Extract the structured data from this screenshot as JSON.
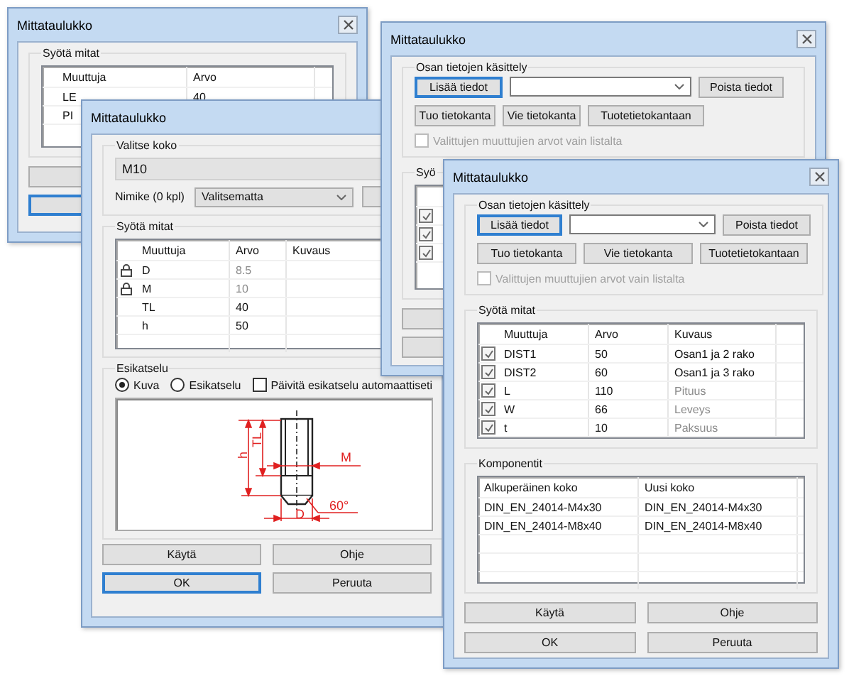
{
  "back_window": {
    "title": "Mittataulukko",
    "group_label": "Syötä mitat",
    "columns": [
      "Muuttuja",
      "Arvo"
    ],
    "rows": [
      {
        "name": "LE",
        "value": "40"
      },
      {
        "name": "PI"
      }
    ],
    "buttons": [
      {
        "default": false
      },
      {
        "default": true
      }
    ]
  },
  "size_window": {
    "title": "Mittataulukko",
    "size_group": "Valitse koko",
    "size_value": "M10",
    "item_label": "Nimike (0 kpl)",
    "item_select": "Valitsematta",
    "dims_group": "Syötä mitat",
    "columns": [
      "Muuttuja",
      "Arvo",
      "Kuvaus"
    ],
    "rows": [
      {
        "name": "D",
        "value": "8.5",
        "locked": true
      },
      {
        "name": "M",
        "value": "10",
        "locked": true
      },
      {
        "name": "TL",
        "value": "40",
        "locked": false
      },
      {
        "name": "h",
        "value": "50",
        "locked": false
      }
    ],
    "preview_group": "Esikatselu",
    "preview_modes": [
      {
        "label": "Kuva",
        "selected": true
      },
      {
        "label": "Esikatselu",
        "selected": false
      }
    ],
    "auto_update": {
      "label": "Päivitä esikatselu automaattiseti",
      "checked": false
    },
    "drawing_labels": [
      "h",
      "TL",
      "M",
      "D",
      "60°"
    ],
    "buttons": [
      {
        "label": "Käytä",
        "default": false
      },
      {
        "label": "Ohje",
        "default": false
      },
      {
        "label": "OK",
        "default": true
      },
      {
        "label": "Peruuta",
        "default": false
      }
    ]
  },
  "database_window": {
    "title": "Mittataulukko",
    "data_group": "Osan tietojen käsittely",
    "data_rows": [
      [
        {
          "kind": "button",
          "label": "Lisää tiedot",
          "focused": true
        },
        {
          "kind": "combo"
        },
        {
          "kind": "button",
          "label": "Poista tiedot",
          "focused": false
        }
      ],
      [
        {
          "kind": "button",
          "label": "Tuo tietokanta",
          "focused": false
        },
        {
          "kind": "button",
          "label": "Vie tietokanta",
          "focused": false
        },
        {
          "kind": "button",
          "label": "Tuotetietokantaan",
          "focused": false
        }
      ]
    ],
    "list_only": {
      "label": "Valittujen muuttujien arvot vain listalta",
      "checked": false,
      "disabled": true
    },
    "dims_group": "Syö",
    "rows": [
      {
        "checked": true
      },
      {
        "checked": true
      },
      {
        "checked": true
      }
    ],
    "lower_buttons": [
      {
        "default": false
      },
      {
        "default": false
      }
    ]
  },
  "front_window": {
    "title": "Mittataulukko",
    "data_group": "Osan tietojen käsittely",
    "data_rows": [
      [
        {
          "kind": "button",
          "label": "Lisää tiedot",
          "focused": true
        },
        {
          "kind": "combo"
        },
        {
          "kind": "button",
          "label": "Poista tiedot",
          "focused": false
        }
      ],
      [
        {
          "kind": "button",
          "label": "Tuo tietokanta",
          "focused": false
        },
        {
          "kind": "button",
          "label": "Vie tietokanta",
          "focused": false
        },
        {
          "kind": "button",
          "label": "Tuotetietokantaan",
          "focused": false
        }
      ]
    ],
    "list_only": {
      "label": "Valittujen muuttujien arvot vain listalta",
      "checked": false,
      "disabled": true
    },
    "dims_group": "Syötä mitat",
    "columns": [
      "Muuttuja",
      "Arvo",
      "Kuvaus"
    ],
    "rows": [
      {
        "checked": true,
        "name": "DIST1",
        "value": "50",
        "description": "Osan1 ja 2 rako",
        "greyed": false
      },
      {
        "checked": true,
        "name": "DIST2",
        "value": "60",
        "description": "Osan1 ja 3 rako",
        "greyed": false
      },
      {
        "checked": true,
        "name": "L",
        "value": "110",
        "description": "Pituus",
        "greyed": true
      },
      {
        "checked": true,
        "name": "W",
        "value": "66",
        "description": "Leveys",
        "greyed": true
      },
      {
        "checked": true,
        "name": "t",
        "value": "10",
        "description": "Paksuus",
        "greyed": true
      }
    ],
    "components_group": "Komponentit",
    "component_columns": [
      "Alkuperäinen koko",
      "Uusi koko"
    ],
    "components": [
      {
        "original": "DIN_EN_24014-M4x30",
        "new": "DIN_EN_24014-M4x30"
      },
      {
        "original": "DIN_EN_24014-M8x40",
        "new": "DIN_EN_24014-M8x40"
      }
    ],
    "buttons": [
      {
        "label": "Käytä",
        "default": false
      },
      {
        "label": "Ohje",
        "default": false
      },
      {
        "label": "OK",
        "default": false
      },
      {
        "label": "Peruuta",
        "default": false
      }
    ]
  }
}
